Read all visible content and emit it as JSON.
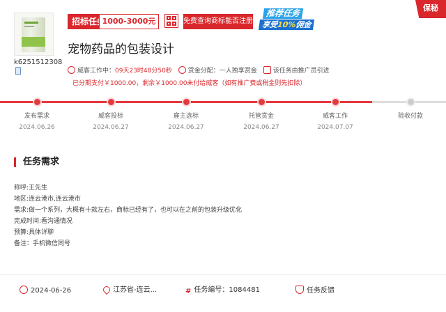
{
  "header": {
    "user_id": "k6251512308",
    "task_type": "招标任务",
    "price_range": "1000-3000元",
    "check_button": "免费查询商标能否注册",
    "promo_line1": "推荐任务",
    "promo_line2_prefix": "享受",
    "promo_line2_highlight": "10%",
    "promo_line2_suffix": "佣金",
    "corner_label": "保秘",
    "title": "宠物药品的包装设计",
    "meta": {
      "status_label": "威客工作中：",
      "countdown": "09天23时48分50秒",
      "reward_label": "赏金分配：",
      "reward_mode": "一人独享赏金",
      "referral": "该任务由推广员引进"
    },
    "notice": "已分期支付￥1000.00，剩余￥1000.00未付给威客（如有推广费或税金则先扣除）"
  },
  "progress": {
    "steps": [
      {
        "name": "发布需求",
        "date": "2024.06.26"
      },
      {
        "name": "威客投标",
        "date": "2024.06.27"
      },
      {
        "name": "雇主选标",
        "date": "2024.06.27"
      },
      {
        "name": "托管赏金",
        "date": "2024.06.27"
      },
      {
        "name": "威客工作",
        "date": "2024.07.07"
      },
      {
        "name": "验收付款",
        "date": ""
      }
    ]
  },
  "requirements": {
    "title": "任务需求",
    "lines": [
      "称呼:王先生",
      "地区:连云港市,连云港市",
      "需求:做一个系列，大概有十款左右，商标已经有了，也可以在之前的包装升级优化",
      "完成时间:看沟通情况",
      "预算:具体详聊",
      "备注：手机微信同号"
    ]
  },
  "footer": {
    "date": "2024-06-26",
    "location": "江苏省-连云...",
    "task_no": "任务编号：1084481",
    "feedback": "任务反馈"
  },
  "colors": {
    "accent": "#d9272c",
    "progress": "#e33a3e"
  }
}
